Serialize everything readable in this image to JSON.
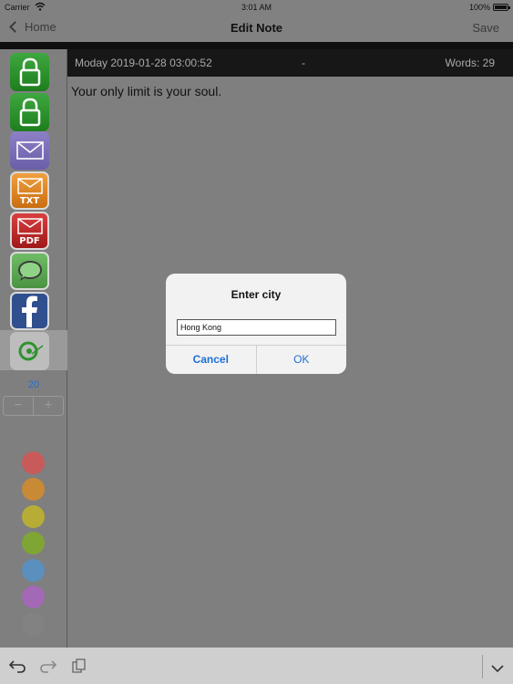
{
  "status_bar": {
    "carrier": "Carrier",
    "time": "3:01 AM",
    "battery": "100%"
  },
  "nav": {
    "back_label": "Home",
    "title": "Edit Note",
    "save_label": "Save"
  },
  "sidebar": {
    "buttons": [
      {
        "icon": "lock-icon",
        "color": "#2e932e"
      },
      {
        "icon": "lock-icon",
        "color": "#2e932e"
      },
      {
        "icon": "mail-icon",
        "color": "#7b6fb6"
      },
      {
        "icon": "mail-txt-icon",
        "label": "TXT",
        "color": "#e08a2a"
      },
      {
        "icon": "mail-pdf-icon",
        "label": "PDF",
        "color": "#c42a2a"
      },
      {
        "icon": "message-icon",
        "color": "#5aa852"
      },
      {
        "icon": "facebook-icon",
        "color": "#2f4f8f"
      },
      {
        "icon": "map-pin-icon",
        "color": "#bdbdbd"
      }
    ],
    "font_size": "20",
    "stepper": {
      "minus": "−",
      "plus": "+"
    },
    "colors": [
      "#c95a5a",
      "#c98a35",
      "#b7ad36",
      "#7fa535",
      "#5b8fbe",
      "#a469b6",
      "#828282"
    ]
  },
  "info_bar": {
    "date": "Moday 2019-01-28 03:00:52",
    "separator": "-",
    "words": "Words: 29"
  },
  "editor": {
    "text": "Your only limit is your soul."
  },
  "dialog": {
    "title": "Enter city",
    "input_value": "Hong Kong",
    "cancel_label": "Cancel",
    "ok_label": "OK"
  },
  "toolbar": {
    "icons": [
      "undo-icon",
      "redo-icon",
      "copy-icon",
      "chevron-down-icon"
    ]
  }
}
